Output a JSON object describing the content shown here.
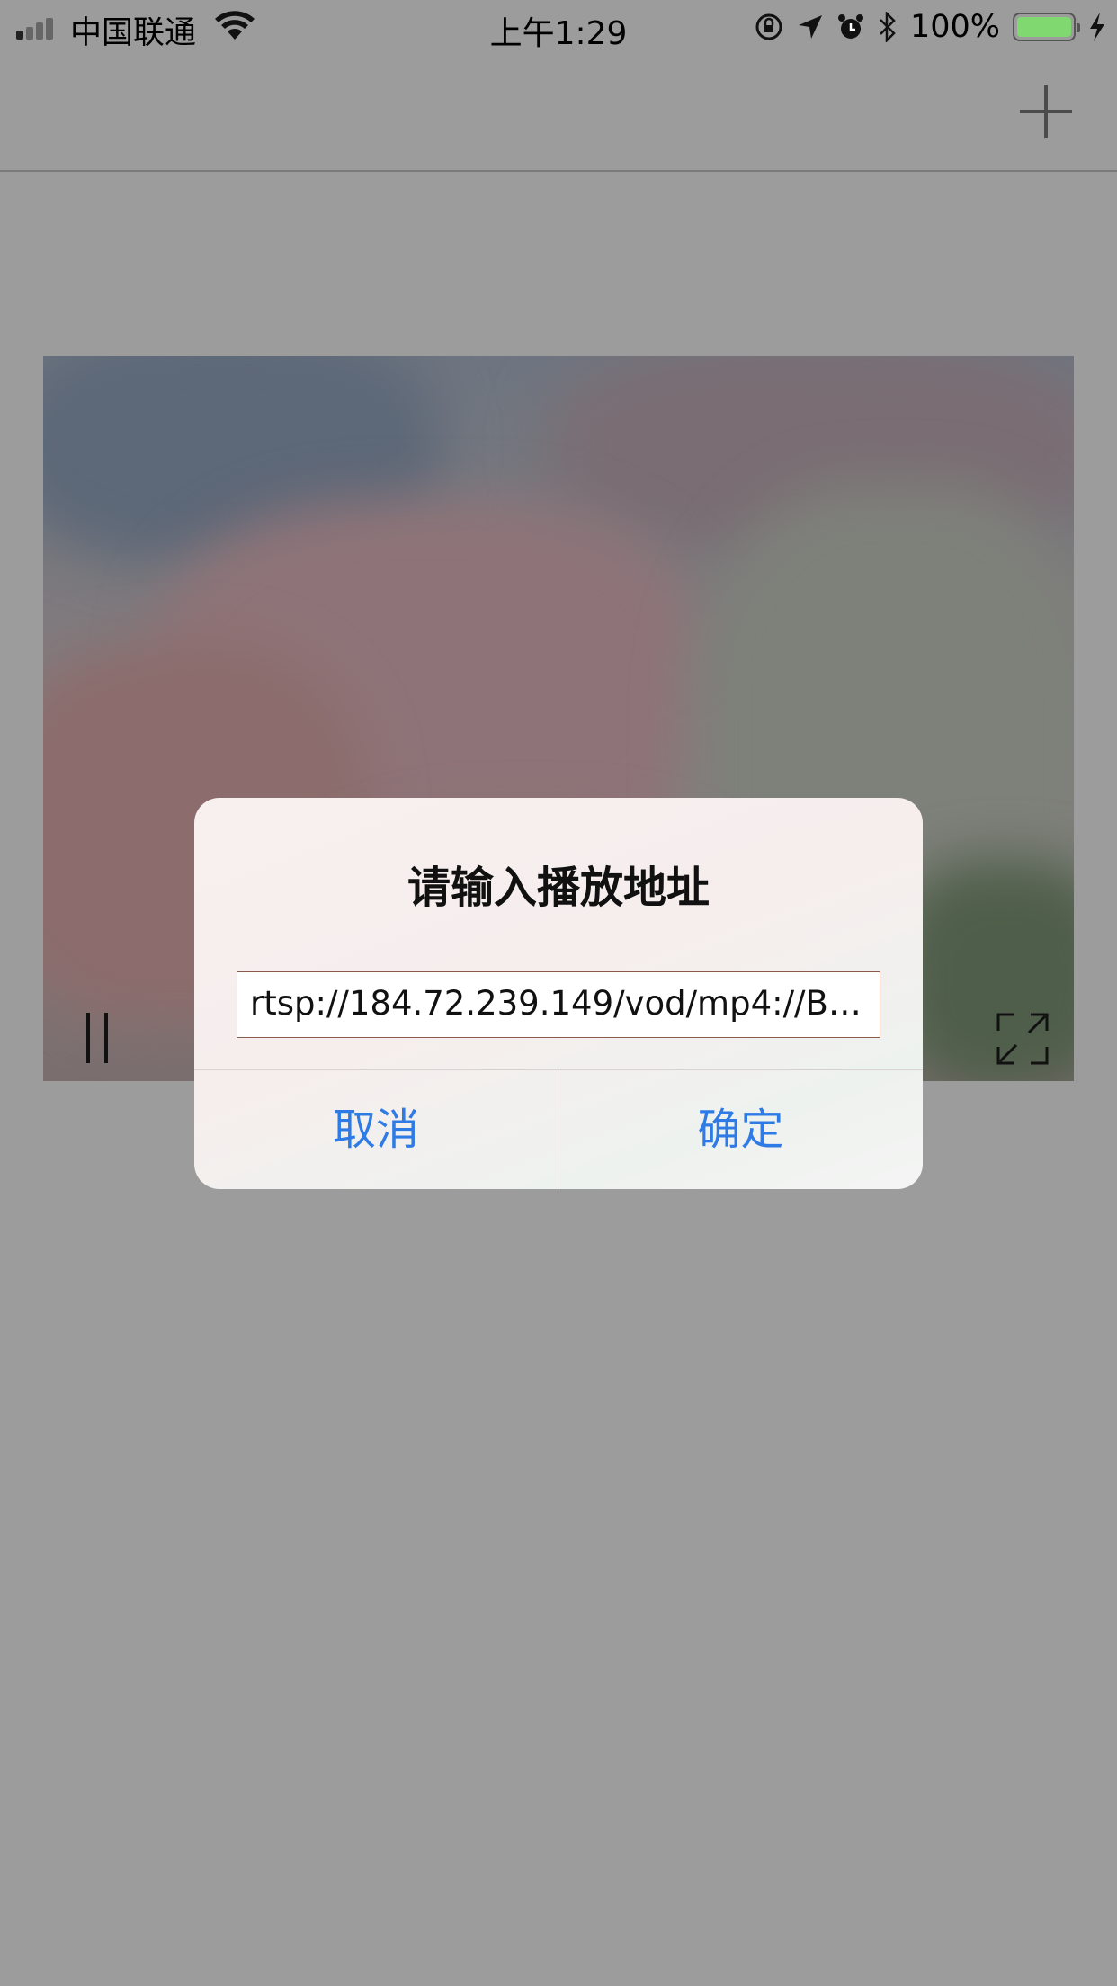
{
  "status_bar": {
    "carrier": "中国联通",
    "time": "上午1:29",
    "battery_percent": "100%",
    "battery_level": 1.0,
    "battery_color": "#7fd970"
  },
  "nav": {
    "add_icon": "plus-icon"
  },
  "video": {
    "pause_icon": "pause-icon",
    "fullscreen_icon": "fullscreen-icon"
  },
  "alert": {
    "title": "请输入播放地址",
    "input_value": "rtsp://184.72.239.149/vod/mp4://Bi...",
    "cancel_label": "取消",
    "confirm_label": "确定",
    "button_color": "#2f7be6"
  }
}
